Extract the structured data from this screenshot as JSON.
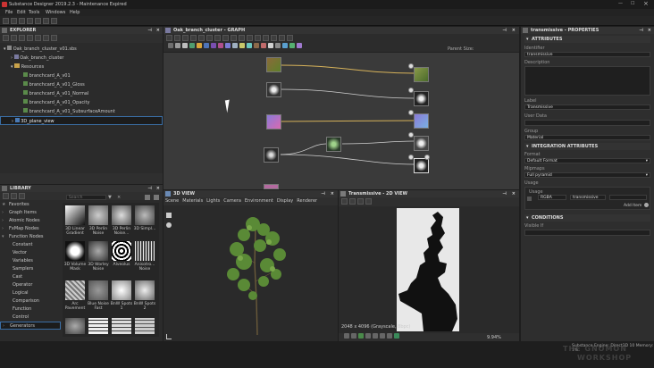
{
  "window": {
    "title": "Substance Designer 2019.2.3 - Maintenance Expired"
  },
  "menu": [
    "File",
    "Edit",
    "Tools",
    "Windows",
    "Help"
  ],
  "explorer": {
    "title": "EXPLORER",
    "tree": [
      {
        "label": "Oak_branch_cluster_v01.sbs",
        "depth": 0
      },
      {
        "label": "Oak_branch_cluster",
        "depth": 1
      },
      {
        "label": "Resources",
        "depth": 1
      },
      {
        "label": "branchcard_A_v01",
        "depth": 2
      },
      {
        "label": "branchcard_A_v01_Gloss",
        "depth": 2
      },
      {
        "label": "branchcard_A_v01_Normal",
        "depth": 2
      },
      {
        "label": "branchcard_A_v01_Opacity",
        "depth": 2
      },
      {
        "label": "branchcard_A_v01_SubsurfaceAmount",
        "depth": 2
      },
      {
        "label": "3D_plane_view",
        "depth": 1
      }
    ]
  },
  "graph": {
    "title": "Oak_branch_cluster - GRAPH",
    "parent_size": "Parent Size:"
  },
  "library": {
    "title": "LIBRARY",
    "search_placeholder": "Search",
    "categories": [
      "Favorites",
      "Graph Items",
      "Atomic Nodes",
      "FxMap Nodes",
      "Function Nodes",
      "Constant",
      "Vector",
      "Variables",
      "Samplers",
      "Cast",
      "Operator",
      "Logical",
      "Comparison",
      "Function",
      "Control",
      "Generators"
    ],
    "items": [
      {
        "label": "3D Linear Gradient"
      },
      {
        "label": "3D Perlin Noise"
      },
      {
        "label": "3D Perlin Noise..."
      },
      {
        "label": "3D Simpl..."
      },
      {
        "label": "3D Volume Mask"
      },
      {
        "label": "3D Worley Noise"
      },
      {
        "label": "Alveolus"
      },
      {
        "label": "Anisotro... Noise"
      },
      {
        "label": "Arc Pavement"
      },
      {
        "label": "Blue Noise Fast"
      },
      {
        "label": "BnW Spots 1"
      },
      {
        "label": "BnW Spots 2"
      }
    ]
  },
  "view3d": {
    "title": "3D VIEW",
    "menu": [
      "Scene",
      "Materials",
      "Lights",
      "Camera",
      "Environment",
      "Display",
      "Renderer"
    ]
  },
  "view2d": {
    "title": "Transmissive - 2D VIEW",
    "status": "2048 x 4096 (Grayscale, 8bpc)",
    "zoom": "9.94%"
  },
  "properties": {
    "title": "transmissive - PROPERTIES",
    "attributes_title": "ATTRIBUTES",
    "identifier_label": "Identifier",
    "identifier_value": "transmissive",
    "description_label": "Description",
    "label_label": "Label",
    "label_value": "Transmissive",
    "userdata_label": "User Data",
    "group_label": "Group",
    "group_value": "Material",
    "integration_title": "INTEGRATION ATTRIBUTES",
    "format_label": "Format",
    "format_value": "Default Format",
    "mipmaps_label": "Mipmaps",
    "mipmaps_value": "Full pyramid",
    "usage_label": "Usage",
    "usage_sub": "Usage",
    "usage_components": "RGBA",
    "usage_value": "transmissive",
    "add_item": "Add Item",
    "conditions_title": "CONDITIONS",
    "visible_if_label": "Visible If"
  },
  "statusbar": {
    "engine": "Substance Engine: Direct3D 10  Memory: 1%"
  },
  "watermark": {
    "line1": "THE GNOMON",
    "line2": "WORKSHOP"
  }
}
